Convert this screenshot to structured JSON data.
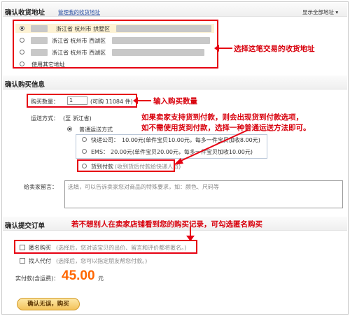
{
  "address_section": {
    "title": "确认收货地址",
    "manage_link": "管理我的收货地址",
    "show_all": "显示全部地址",
    "addresses": [
      {
        "province": "浙江省",
        "city": "杭州市",
        "district": "拱墅区",
        "selected": true
      },
      {
        "province": "浙江省",
        "city": "杭州市",
        "district": "西湖区",
        "selected": false
      },
      {
        "province": "浙江省",
        "city": "杭州市",
        "district": "西湖区",
        "selected": false
      }
    ],
    "other_address": "使用其它地址",
    "note": "选择这笔交易的收货地址"
  },
  "purchase_section": {
    "title": "确认购买信息",
    "quantity_label": "购买数量：",
    "quantity_value": "1",
    "stock": "(可购 11084 件)",
    "quantity_note": "输入购买数量",
    "shipping_label": "运送方式：",
    "shipping_destination": "(至 浙江省)",
    "normal_shipping": "普通运送方式",
    "express": "快递公司：",
    "express_price": "10.00元(单件宝贝10.00元，每多一件宝贝加收8.00元)",
    "ems": "EMS：",
    "ems_price": "20.00元(单件宝贝20.00元，每多一件宝贝加收10.00元)",
    "cod": "货到付款",
    "cod_desc": "(收到货后付款给快递人员)",
    "cod_note_line1": "如果卖家支持货到付款，则会出现货到付款选项，",
    "cod_note_line2": "如不需使用货到付款，选择一种普通运送方法即可。",
    "message_label": "给卖家留言：",
    "message_placeholder": "选填，可以告诉卖家您对商品的特殊要求，如：颜色、尺码等"
  },
  "submit_section": {
    "title": "确认提交订单",
    "anonymous_note": "若不想别人在卖家店铺看到您的购买记录，可勾选匿名购买",
    "anonymous_label": "匿名购买",
    "anonymous_desc": "(选择后，您对该宝贝的出价、留言和评价都将匿名。)",
    "proxy_label": "找人代付",
    "proxy_desc": "(选择后，您可以指定朋友帮您付款。)",
    "total_label": "实付款(含运费)：",
    "total_amount": "45.00",
    "currency": "元",
    "confirm_button": "确认无误，购买"
  },
  "colors": {
    "accent_red": "#e60012",
    "price_orange": "#ff6600",
    "link_blue": "#2a4fa3"
  }
}
